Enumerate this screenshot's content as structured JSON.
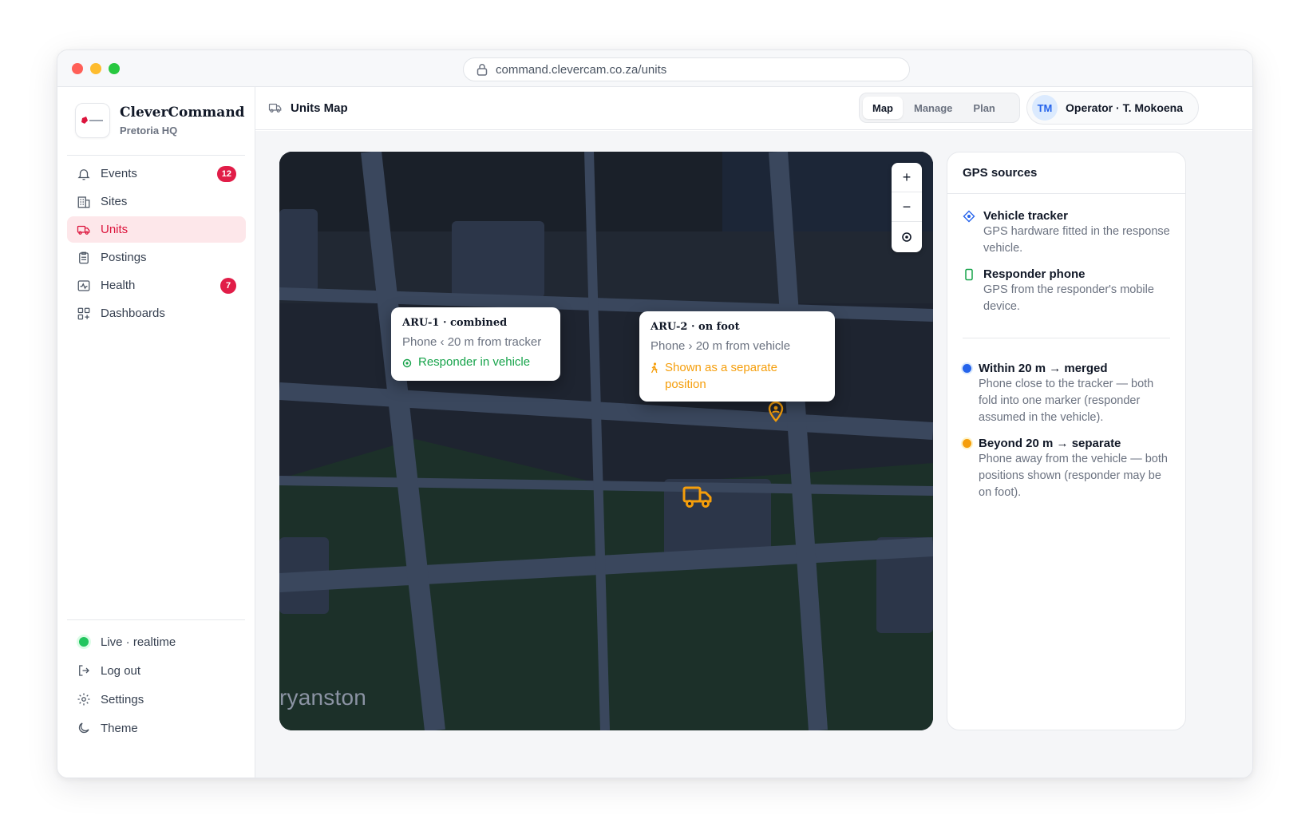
{
  "browser": {
    "url": "command.clevercam.co.za/units"
  },
  "sidebar": {
    "brand_title": "CleverCommand",
    "brand_sub": "Pretoria HQ",
    "items": [
      {
        "label": "Events",
        "icon": "bell-icon",
        "badge": "12"
      },
      {
        "label": "Sites",
        "icon": "building-icon"
      },
      {
        "label": "Units",
        "icon": "truck-icon",
        "active": true
      },
      {
        "label": "Postings",
        "icon": "clipboard-icon"
      },
      {
        "label": "Health",
        "icon": "pulse-icon",
        "badge": "7"
      },
      {
        "label": "Dashboards",
        "icon": "grid-icon"
      }
    ],
    "bottom": [
      {
        "label": "Live · realtime",
        "icon": "status-dot"
      },
      {
        "label": "Log out",
        "icon": "logout-icon"
      },
      {
        "label": "Settings",
        "icon": "gear-icon"
      },
      {
        "label": "Theme",
        "icon": "moon-icon"
      }
    ]
  },
  "header": {
    "title": "Units Map",
    "tabs": [
      "Map",
      "Manage",
      "Plan"
    ],
    "active_tab": "Map",
    "user_initials": "TM",
    "user_label": "Operator · T. Mokoena"
  },
  "map": {
    "place_label": "ryanston",
    "zoom_in": "+",
    "zoom_out": "−",
    "callout1": {
      "title": "ARU-1 · combined",
      "line": "Phone ‹ 20 m from tracker",
      "status": "Responder in vehicle"
    },
    "callout2": {
      "title": "ARU-2 · on foot",
      "line": "Phone › 20 m from vehicle",
      "status": "Shown as a separate position"
    }
  },
  "panel": {
    "title": "GPS sources",
    "sources": [
      {
        "title": "Vehicle tracker",
        "desc": "GPS hardware fitted in the response vehicle."
      },
      {
        "title": "Responder phone",
        "desc": "GPS from the responder's mobile device."
      }
    ],
    "legend": [
      {
        "title": "Within 20 m → merged",
        "desc": "Phone close to the tracker — both fold into one marker (responder assumed in the vehicle).",
        "color": "#2563eb"
      },
      {
        "title": "Beyond 20 m → separate",
        "desc": "Phone away from the vehicle — both positions shown (responder may be on foot).",
        "color": "#f59e0b"
      }
    ]
  },
  "colors": {
    "accent": "#dc143c",
    "amber": "#f59e0b",
    "green": "#16a34a",
    "blue": "#2563eb"
  }
}
